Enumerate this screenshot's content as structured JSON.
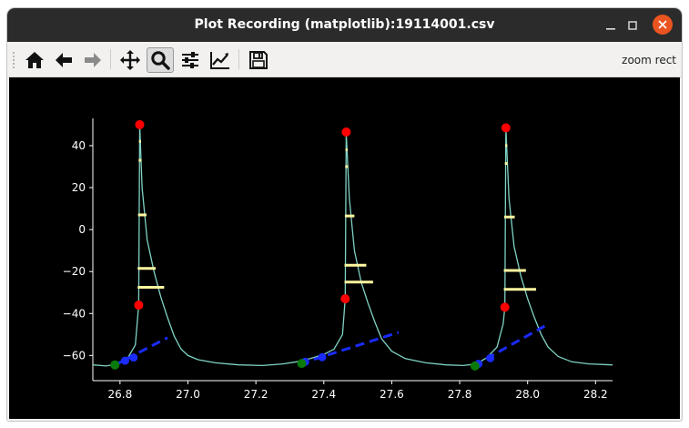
{
  "window": {
    "title": "Plot Recording (matplotlib):19114001.csv"
  },
  "toolbar": {
    "buttons": [
      {
        "name": "home-icon"
      },
      {
        "name": "back-arrow-icon"
      },
      {
        "name": "forward-arrow-icon"
      },
      {
        "name": "pan-move-icon"
      },
      {
        "name": "zoom-magnifier-icon",
        "active": true
      },
      {
        "name": "configure-subplots-icon"
      },
      {
        "name": "edit-axis-icon"
      },
      {
        "name": "save-figure-icon"
      }
    ],
    "mode_label": "zoom rect"
  },
  "chart_data": {
    "type": "line",
    "xlim": [
      26.72,
      28.25
    ],
    "ylim": [
      -72,
      53
    ],
    "x_ticks": [
      26.8,
      27.0,
      27.2,
      27.4,
      27.6,
      27.8,
      28.0,
      28.2
    ],
    "y_ticks": [
      40,
      20,
      0,
      -20,
      -40,
      -60
    ],
    "colors": {
      "trace": "#7fd3c4",
      "peak": "#ff0000",
      "threshold": "#ff0000",
      "fit_line": "#1a2bff",
      "baseline_point": "#0a7a0a",
      "width_bar": "#fff8a0",
      "axis": "#ffffff",
      "background": "#000000"
    },
    "trace": [
      [
        26.72,
        -64.5
      ],
      [
        26.76,
        -65
      ],
      [
        26.79,
        -64
      ],
      [
        26.82,
        -62
      ],
      [
        26.845,
        -55
      ],
      [
        26.855,
        -36
      ],
      [
        26.858,
        50
      ],
      [
        26.865,
        20
      ],
      [
        26.88,
        -5
      ],
      [
        26.9,
        -20
      ],
      [
        26.92,
        -32
      ],
      [
        26.94,
        -42
      ],
      [
        26.96,
        -51
      ],
      [
        26.98,
        -57
      ],
      [
        27.0,
        -60
      ],
      [
        27.03,
        -62
      ],
      [
        27.08,
        -63.5
      ],
      [
        27.15,
        -64.5
      ],
      [
        27.22,
        -64.8
      ],
      [
        27.28,
        -64
      ],
      [
        27.32,
        -63
      ],
      [
        27.36,
        -61.5
      ],
      [
        27.4,
        -59.5
      ],
      [
        27.43,
        -57
      ],
      [
        27.455,
        -50
      ],
      [
        27.463,
        -33
      ],
      [
        27.466,
        46
      ],
      [
        27.475,
        15
      ],
      [
        27.49,
        -10
      ],
      [
        27.51,
        -25
      ],
      [
        27.53,
        -35
      ],
      [
        27.55,
        -44
      ],
      [
        27.57,
        -52
      ],
      [
        27.6,
        -58
      ],
      [
        27.64,
        -61.5
      ],
      [
        27.7,
        -63.5
      ],
      [
        27.76,
        -64.5
      ],
      [
        27.81,
        -64.8
      ],
      [
        27.85,
        -64
      ],
      [
        27.88,
        -61
      ],
      [
        27.91,
        -56
      ],
      [
        27.928,
        -45
      ],
      [
        27.933,
        -37
      ],
      [
        27.936,
        48.5
      ],
      [
        27.945,
        15
      ],
      [
        27.96,
        -8
      ],
      [
        27.98,
        -22
      ],
      [
        28.0,
        -33
      ],
      [
        28.02,
        -42
      ],
      [
        28.04,
        -50
      ],
      [
        28.06,
        -56
      ],
      [
        28.09,
        -60.5
      ],
      [
        28.13,
        -63
      ],
      [
        28.18,
        -64
      ],
      [
        28.25,
        -64.5
      ]
    ],
    "peaks": [
      [
        26.858,
        50
      ],
      [
        27.466,
        46.5
      ],
      [
        27.936,
        48.5
      ]
    ],
    "thresholds": [
      [
        26.855,
        -36
      ],
      [
        27.463,
        -33
      ],
      [
        27.933,
        -37
      ]
    ],
    "fit_lines": [
      {
        "x": [
          26.78,
          26.94
        ],
        "y": [
          -65,
          -51.5
        ]
      },
      {
        "x": [
          27.33,
          27.62
        ],
        "y": [
          -64,
          -49
        ]
      },
      {
        "x": [
          27.84,
          28.05
        ],
        "y": [
          -65,
          -46
        ]
      }
    ],
    "fit_points": [
      [
        26.815,
        -62.5
      ],
      [
        26.84,
        -61
      ],
      [
        27.345,
        -63
      ],
      [
        27.395,
        -60.8
      ],
      [
        27.855,
        -64
      ],
      [
        27.89,
        -61.3
      ]
    ],
    "baseline_points": [
      [
        26.785,
        -64.5
      ],
      [
        27.335,
        -63.8
      ],
      [
        27.845,
        -65
      ]
    ],
    "width_bars": [
      {
        "y": 42,
        "x1": 26.856,
        "x2": 26.862
      },
      {
        "y": 33,
        "x1": 26.855,
        "x2": 26.863
      },
      {
        "y": 7,
        "x1": 26.853,
        "x2": 26.878
      },
      {
        "y": -18.5,
        "x1": 26.852,
        "x2": 26.905
      },
      {
        "y": -27.5,
        "x1": 26.852,
        "x2": 26.93
      },
      {
        "y": 38,
        "x1": 27.464,
        "x2": 27.47
      },
      {
        "y": 30,
        "x1": 27.463,
        "x2": 27.471
      },
      {
        "y": 6.5,
        "x1": 27.462,
        "x2": 27.49
      },
      {
        "y": -17,
        "x1": 27.461,
        "x2": 27.525
      },
      {
        "y": -25,
        "x1": 27.461,
        "x2": 27.545
      },
      {
        "y": 40,
        "x1": 27.934,
        "x2": 27.94
      },
      {
        "y": 31.5,
        "x1": 27.933,
        "x2": 27.941
      },
      {
        "y": 6,
        "x1": 27.931,
        "x2": 27.962
      },
      {
        "y": -19.5,
        "x1": 27.93,
        "x2": 27.995
      },
      {
        "y": -28.5,
        "x1": 27.93,
        "x2": 28.025
      }
    ]
  }
}
